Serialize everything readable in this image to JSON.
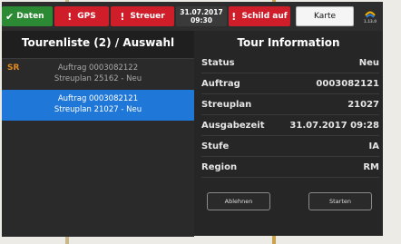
{
  "topbar": {
    "daten_label": "Daten",
    "gps_label": "GPS",
    "streuer_label": "Streuer",
    "date": "31.07.2017",
    "time": "09:30",
    "schild_label": "Schild auf",
    "karte_label": "Karte",
    "logo_version": "1.13.0"
  },
  "left": {
    "title": "Tourenliste (2) / Auswahl",
    "items": [
      {
        "badge": "SR",
        "line1": "Auftrag 0003082122",
        "line2": "Streuplan 25162 - Neu"
      },
      {
        "badge": "",
        "line1": "Auftrag 0003082121",
        "line2": "Streuplan 21027 - Neu"
      }
    ]
  },
  "right": {
    "title": "Tour Information",
    "rows": [
      {
        "label": "Status",
        "value": "Neu"
      },
      {
        "label": "Auftrag",
        "value": "0003082121"
      },
      {
        "label": "Streuplan",
        "value": "21027"
      },
      {
        "label": "Ausgabezeit",
        "value": "31.07.2017 09:28"
      },
      {
        "label": "Stufe",
        "value": "IA"
      },
      {
        "label": "Region",
        "value": "RM"
      }
    ],
    "reject_label": "Ablehnen",
    "start_label": "Starten"
  },
  "colors": {
    "ok": "#2c8a34",
    "alert": "#d01d2a",
    "selected": "#1f77d8",
    "badge": "#e08a1e"
  }
}
